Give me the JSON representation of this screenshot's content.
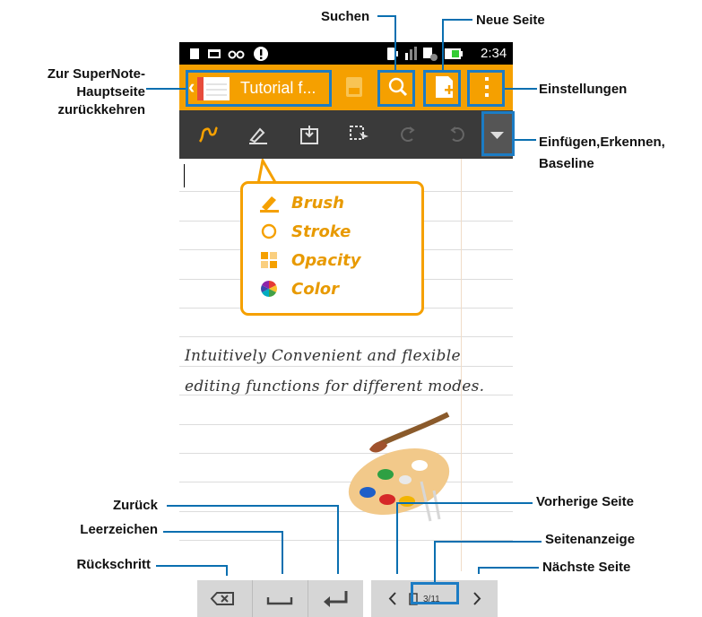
{
  "callouts": {
    "back_to_main": "Zur SuperNote-\nHauptseite\nzurückkehren",
    "search": "Suchen",
    "new_page": "Neue Seite",
    "settings": "Einstellungen",
    "insert": "Einfügen,Erkennen,\nBaseline",
    "return": "Zurück",
    "space": "Leerzeichen",
    "backspace": "Rückschritt",
    "prev_page": "Vorherige Seite",
    "page_indicator": "Seitenanzeige",
    "next_page": "Nächste Seite"
  },
  "status_bar": {
    "time": "2:34"
  },
  "action_bar": {
    "title": "Tutorial f..."
  },
  "bubble": {
    "items": [
      {
        "label": "Brush",
        "icon": "brush-icon"
      },
      {
        "label": "Stroke",
        "icon": "stroke-circle-icon"
      },
      {
        "label": "Opacity",
        "icon": "opacity-icon"
      },
      {
        "label": "Color",
        "icon": "color-wheel-icon"
      }
    ]
  },
  "note": {
    "line1": "Intuitively Convenient and flexible",
    "line2": "editing functions for different modes."
  },
  "pager": {
    "indicator": "3/11"
  },
  "colors": {
    "accent": "#f5a000",
    "callout_line": "#0a6fb0",
    "toolbar": "#3a3a3a"
  }
}
